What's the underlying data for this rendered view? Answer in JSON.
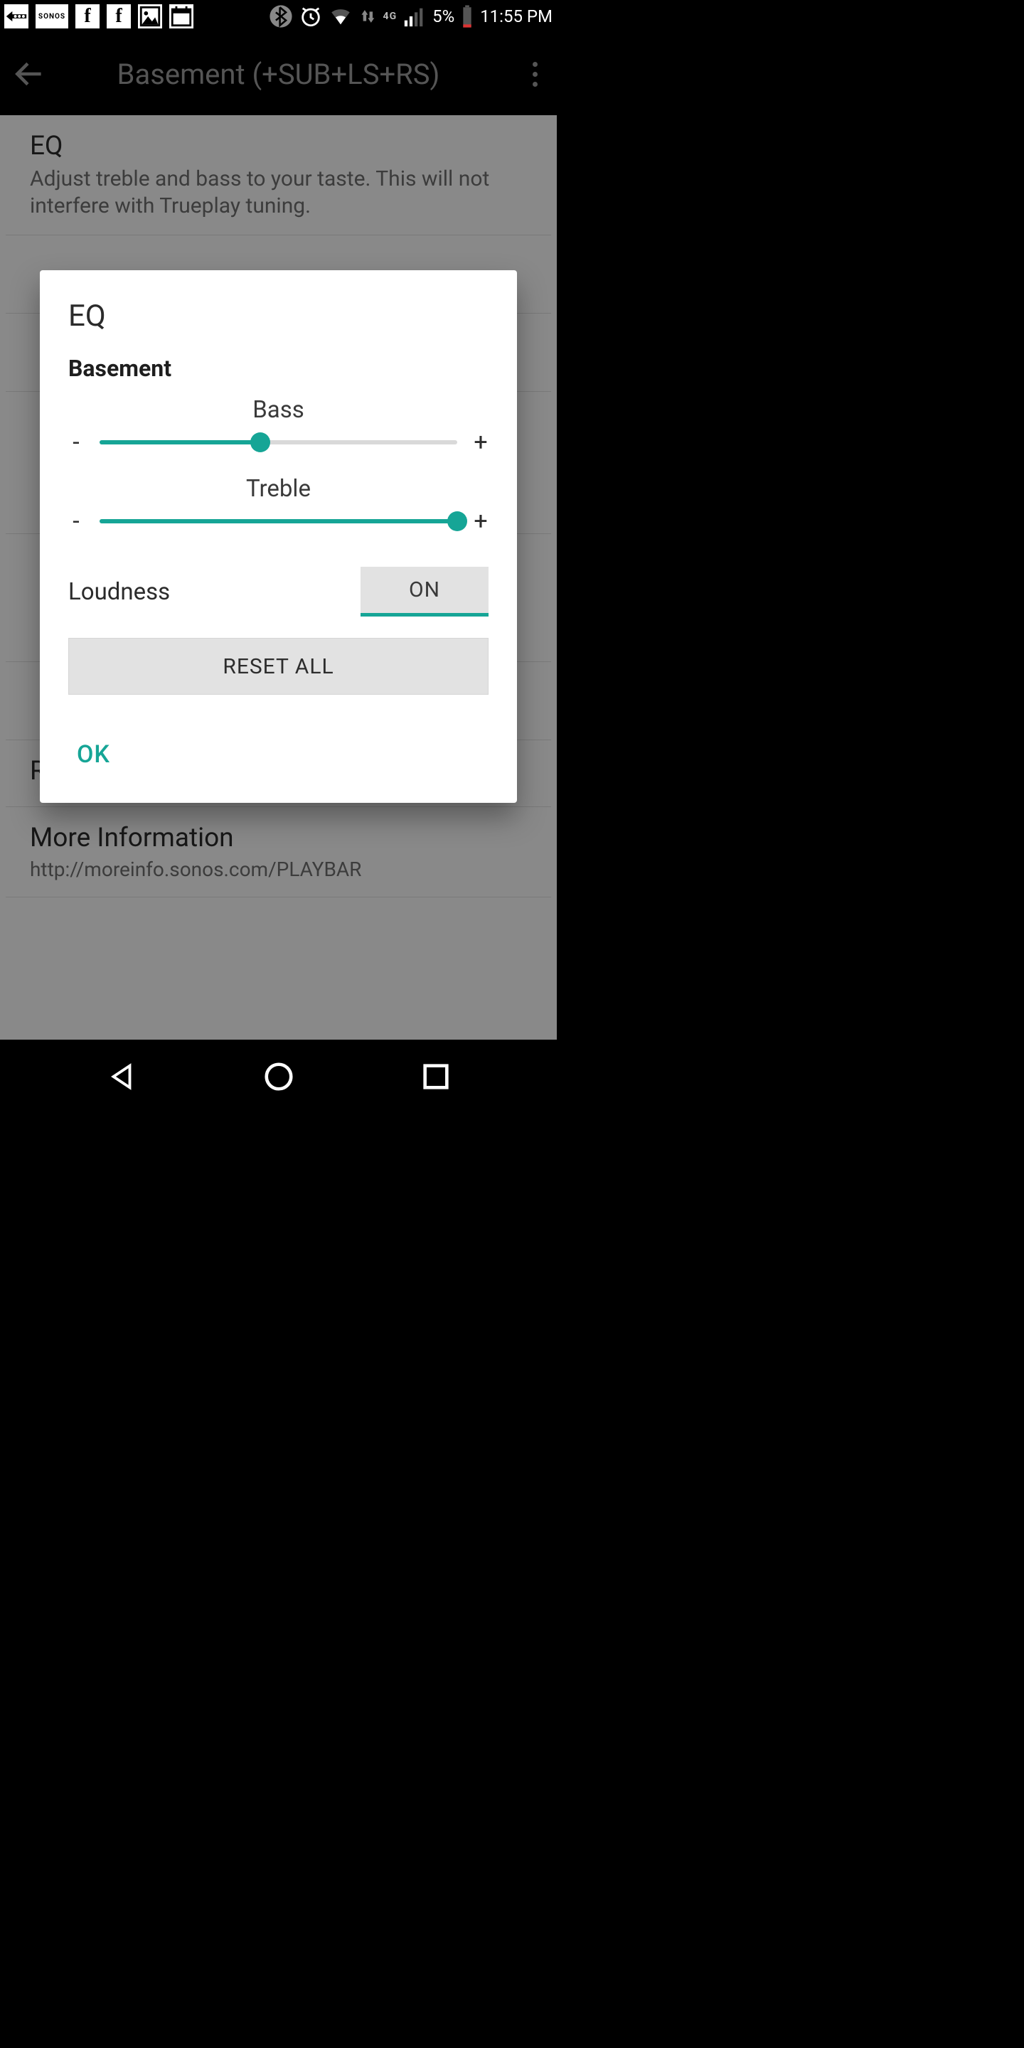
{
  "statusbar": {
    "sonos_label": "SONOS",
    "network_label": "4G",
    "battery_pct": "5%",
    "time": "11:55 PM"
  },
  "header": {
    "title": "Basement (+SUB+LS+RS)"
  },
  "background": {
    "eq_title": "EQ",
    "eq_desc": "Adjust treble and bass to your taste. This will not interfere with Trueplay tuning.",
    "remove_surrounds": "Remove Surrounds",
    "more_info_title": "More Information",
    "more_info_link": "http://moreinfo.sonos.com/PLAYBAR"
  },
  "dialog": {
    "title": "EQ",
    "room": "Basement",
    "bass": {
      "label": "Bass",
      "minus": "-",
      "plus": "+",
      "value_pct": 45
    },
    "treble": {
      "label": "Treble",
      "minus": "-",
      "plus": "+",
      "value_pct": 100
    },
    "loudness_label": "Loudness",
    "loudness_state": "ON",
    "reset_label": "RESET ALL",
    "ok_label": "OK"
  }
}
